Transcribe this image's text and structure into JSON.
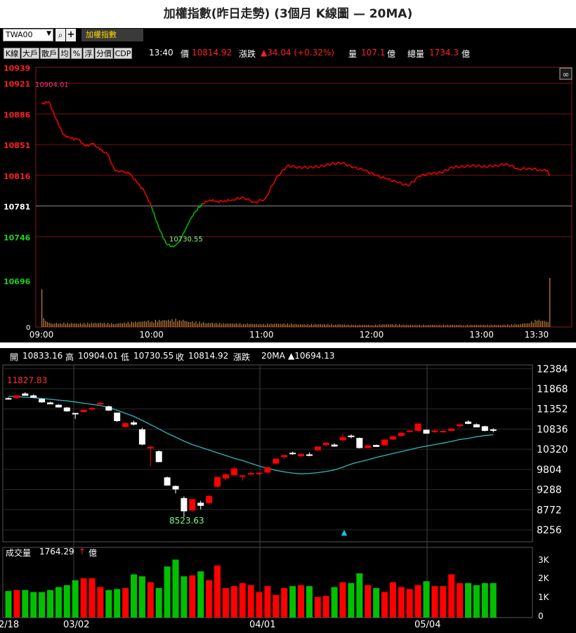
{
  "title": "加權指數(昨日走勢) (3個月 K線圖 — 20MA)",
  "toolbar": {
    "symbol": "TWA00",
    "index_name": "加權指數",
    "buttons": [
      "K線",
      "大戶",
      "散戶",
      "均",
      "%",
      "浮",
      "分價",
      "CDP"
    ],
    "time": "13:40",
    "price_label": "價",
    "price": "10814.92",
    "change_label": "漲跌",
    "change": "▲34.04 (+0.32%)",
    "volume_label": "量",
    "volume": "107.1",
    "volume_unit": "億",
    "total_label": "總量",
    "total": "1734.3",
    "total_unit": "億"
  },
  "ohlc_bar": {
    "open_label": "開",
    "open": "10833.16",
    "high_label": "高",
    "high": "10904.01",
    "low_label": "低",
    "low": "10730.55",
    "close_label": "收",
    "close": "10814.92",
    "change_label": "漲跌",
    "ma_label": "20MA",
    "ma_value": "▲10694.13"
  },
  "volume_bar": {
    "label": "成交量",
    "value": "1764.29",
    "unit": "億"
  },
  "colors": {
    "up": "#ff0000",
    "down": "#00c000",
    "ma": "#2fb7b7",
    "volume_intraday": "#c9843a",
    "background": "#000000"
  },
  "chart_data": [
    {
      "type": "line",
      "name": "intraday",
      "y_ticks": [
        10939,
        10921,
        10886,
        10851,
        10816,
        10781,
        10746,
        10696
      ],
      "reference_price": 10781,
      "ylim": [
        10643,
        10939
      ],
      "x_ticks": [
        "09:00",
        "10:00",
        "11:00",
        "12:00",
        "13:00",
        "13:30"
      ],
      "xlim_minutes": [
        0,
        280
      ],
      "annotations": {
        "high": "10904.01",
        "low": "10730.55"
      },
      "x_minutes": [
        0,
        4,
        8,
        12,
        16,
        20,
        24,
        28,
        32,
        36,
        40,
        44,
        48,
        52,
        56,
        60,
        64,
        68,
        72,
        75,
        78,
        81,
        84,
        88,
        92,
        96,
        100,
        104,
        110,
        116,
        122,
        128,
        134,
        140,
        146,
        152,
        158,
        164,
        170,
        176,
        182,
        188,
        194,
        200,
        206,
        212,
        218,
        224,
        230,
        236,
        242,
        248,
        254,
        260,
        266,
        272,
        276,
        277
      ],
      "y": [
        10897,
        10900,
        10880,
        10862,
        10858,
        10857,
        10849,
        10852,
        10845,
        10840,
        10821,
        10820,
        10818,
        10808,
        10798,
        10780,
        10756,
        10738,
        10734,
        10740,
        10752,
        10765,
        10775,
        10784,
        10788,
        10786,
        10787,
        10788,
        10791,
        10785,
        10789,
        10813,
        10827,
        10825,
        10825,
        10826,
        10829,
        10830,
        10825,
        10822,
        10816,
        10812,
        10808,
        10804,
        10815,
        10818,
        10819,
        10825,
        10826,
        10827,
        10826,
        10827,
        10829,
        10823,
        10824,
        10822,
        10822,
        10815
      ],
      "volume_minutes": [
        0,
        1,
        2,
        3,
        4,
        5,
        6,
        10,
        20,
        30,
        40,
        50,
        60,
        70,
        75,
        80,
        90,
        100,
        110,
        120,
        130,
        140,
        150,
        160,
        170,
        180,
        190,
        200,
        210,
        220,
        230,
        240,
        250,
        260,
        265,
        270,
        276,
        277
      ],
      "volume": [
        60,
        14,
        10,
        8,
        7,
        6,
        5,
        6,
        5,
        6,
        5,
        7,
        9,
        10,
        11,
        8,
        6,
        5,
        5,
        4,
        5,
        4,
        4,
        4,
        3,
        3,
        4,
        3,
        3,
        3,
        3,
        3,
        3,
        4,
        6,
        10,
        8,
        78
      ]
    },
    {
      "type": "candlestick",
      "name": "daily",
      "y_ticks": [
        12384,
        11868,
        11352,
        10836,
        10320,
        9804,
        9288,
        8772,
        8256
      ],
      "ylim": [
        7950,
        12480
      ],
      "x_ticks": [
        "2/18",
        "03/02",
        "04/01",
        "05/04"
      ],
      "annotations": {
        "high": "11827.83",
        "low": "8523.63"
      },
      "candles": [
        [
          11620,
          11650,
          11590,
          11610
        ],
        [
          11640,
          11700,
          11600,
          11690
        ],
        [
          11740,
          11780,
          11690,
          11700
        ],
        [
          11690,
          11730,
          11640,
          11650
        ],
        [
          11600,
          11620,
          11510,
          11530
        ],
        [
          11510,
          11540,
          11470,
          11480
        ],
        [
          11450,
          11470,
          11390,
          11400
        ],
        [
          11380,
          11400,
          11280,
          11300
        ],
        [
          11240,
          11250,
          11100,
          11230
        ],
        [
          11280,
          11330,
          11260,
          11320
        ],
        [
          11350,
          11390,
          11310,
          11370
        ],
        [
          11480,
          11540,
          11440,
          11500
        ],
        [
          11410,
          11440,
          11300,
          11320
        ],
        [
          11250,
          11260,
          11020,
          11050
        ],
        [
          10900,
          11000,
          10870,
          10980
        ],
        [
          11000,
          11050,
          10930,
          10960
        ],
        [
          10820,
          10870,
          10420,
          10450
        ],
        [
          10350,
          10400,
          9880,
          10370
        ],
        [
          10260,
          10290,
          9990,
          10000
        ],
        [
          9590,
          9620,
          9390,
          9400
        ],
        [
          9370,
          9390,
          9190,
          9300
        ],
        [
          9060,
          9110,
          8580,
          8740
        ],
        [
          8760,
          9050,
          8720,
          9030
        ],
        [
          8940,
          9000,
          8780,
          8880
        ],
        [
          8950,
          9130,
          8920,
          9120
        ],
        [
          9370,
          9620,
          9340,
          9600
        ],
        [
          9580,
          9700,
          9520,
          9670
        ],
        [
          9660,
          9880,
          9650,
          9820
        ],
        [
          9630,
          9660,
          9520,
          9640
        ],
        [
          9690,
          9750,
          9660,
          9700
        ],
        [
          9700,
          9720,
          9650,
          9710
        ],
        [
          9730,
          9860,
          9720,
          9850
        ],
        [
          9960,
          10080,
          9950,
          10070
        ],
        [
          10130,
          10180,
          10070,
          10160
        ],
        [
          10220,
          10260,
          10180,
          10210
        ],
        [
          10150,
          10210,
          10120,
          10190
        ],
        [
          10180,
          10240,
          10140,
          10160
        ],
        [
          10300,
          10390,
          10280,
          10380
        ],
        [
          10440,
          10490,
          10390,
          10480
        ],
        [
          10430,
          10470,
          10380,
          10400
        ],
        [
          10560,
          10720,
          10540,
          10620
        ],
        [
          10660,
          10700,
          10600,
          10640
        ],
        [
          10600,
          10620,
          10340,
          10360
        ],
        [
          10360,
          10440,
          10350,
          10410
        ],
        [
          10420,
          10440,
          10380,
          10390
        ],
        [
          10430,
          10580,
          10420,
          10560
        ],
        [
          10580,
          10660,
          10550,
          10640
        ],
        [
          10670,
          10760,
          10640,
          10730
        ],
        [
          10780,
          10800,
          10740,
          10790
        ],
        [
          10800,
          10980,
          10780,
          10970
        ],
        [
          10810,
          10820,
          10720,
          10730
        ],
        [
          10770,
          10830,
          10740,
          10790
        ],
        [
          10770,
          10800,
          10740,
          10780
        ],
        [
          10800,
          10860,
          10780,
          10840
        ],
        [
          10920,
          10960,
          10880,
          10950
        ],
        [
          11020,
          11060,
          10960,
          10980
        ],
        [
          10950,
          10980,
          10880,
          10890
        ],
        [
          10900,
          10920,
          10780,
          10800
        ],
        [
          10820,
          10860,
          10750,
          10810
        ]
      ],
      "ma20": [
        11680,
        11670,
        11655,
        11640,
        11620,
        11600,
        11580,
        11560,
        11530,
        11500,
        11470,
        11440,
        11390,
        11320,
        11240,
        11160,
        11060,
        10950,
        10840,
        10730,
        10630,
        10530,
        10440,
        10370,
        10300,
        10230,
        10160,
        10090,
        10030,
        9960,
        9890,
        9830,
        9780,
        9740,
        9710,
        9690,
        9700,
        9720,
        9750,
        9790,
        9860,
        9940,
        10000,
        10050,
        10110,
        10160,
        10210,
        10260,
        10310,
        10360,
        10400,
        10440,
        10480,
        10520,
        10570,
        10600,
        10640,
        10670,
        10694
      ],
      "volume_yticks": [
        "3K",
        "2K",
        "1K",
        "0"
      ],
      "volume_ylim": [
        0,
        3000
      ],
      "volume": [
        1350,
        1400,
        1400,
        1300,
        1300,
        1400,
        1550,
        1650,
        1900,
        2000,
        2000,
        1550,
        1400,
        1450,
        1500,
        2200,
        2100,
        1800,
        1500,
        2600,
        2950,
        2100,
        2150,
        2350,
        1900,
        2650,
        1500,
        1600,
        1750,
        1650,
        1300,
        1600,
        1150,
        1500,
        1600,
        1650,
        1600,
        1050,
        1100,
        1550,
        1800,
        1750,
        2250,
        1650,
        1500,
        1300,
        1800,
        1550,
        1450,
        1650,
        1850,
        1600,
        1600,
        2200,
        1750,
        1750,
        1650,
        1750,
        1750
      ]
    }
  ]
}
